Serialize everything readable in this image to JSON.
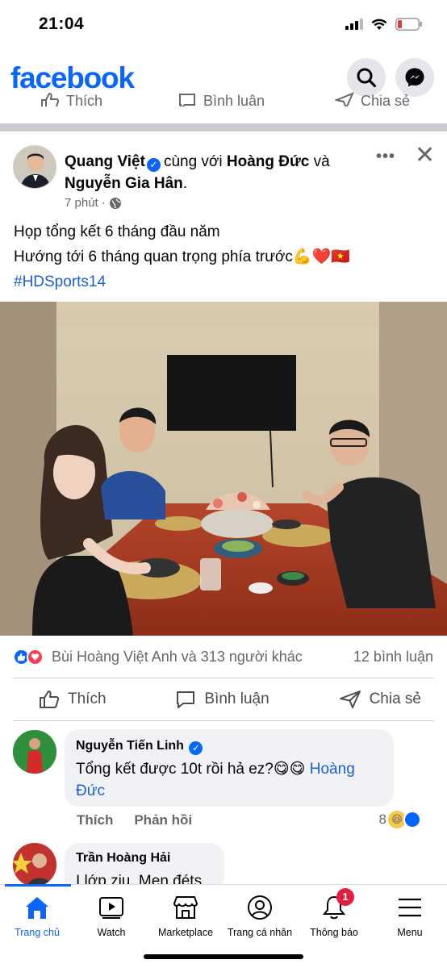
{
  "status_bar": {
    "time": "21:04"
  },
  "header": {
    "logo": "facebook",
    "search_icon": "search-icon",
    "messenger_icon": "messenger-icon",
    "prev_actions": [
      "Thích",
      "Bình luận",
      "Chia sẻ"
    ]
  },
  "post": {
    "author": "Quang Việt",
    "with_text": "cùng với",
    "tagged1": "Hoàng Đức",
    "and_text": "và",
    "tagged2": "Nguyễn Gia Hân",
    "time": "7 phút",
    "privacy_icon": "globe-icon",
    "line1": "Họp tổng kết 6 tháng đầu năm",
    "line2": "Hướng tới 6 tháng quan trọng phía trước💪❤️🇻🇳",
    "hashtag": "#HDSports14",
    "reactions_text": "Bùi Hoàng Việt Anh và 313 người khác",
    "comments_count": "12 bình luận",
    "actions": {
      "like": "Thích",
      "comment": "Bình luận",
      "share": "Chia sẻ"
    }
  },
  "comments": [
    {
      "name": "Nguyễn Tiến Linh",
      "text": "Tổng kết được 10t rồi hả ez?😋😋 ",
      "mention": "Hoàng Đức",
      "like_label": "Thích",
      "reply_label": "Phản hồi",
      "reaction_count": "8"
    },
    {
      "name": "Trần Hoàng Hải",
      "text": "I lớp ziu, Men đéts"
    }
  ],
  "tabs": [
    {
      "label": "Trang chủ",
      "icon": "home-icon"
    },
    {
      "label": "Watch",
      "icon": "video-icon"
    },
    {
      "label": "Marketplace",
      "icon": "store-icon"
    },
    {
      "label": "Trang cá nhân",
      "icon": "profile-icon"
    },
    {
      "label": "Thông báo",
      "icon": "bell-icon",
      "badge": "1"
    },
    {
      "label": "Menu",
      "icon": "menu-icon"
    }
  ],
  "colors": {
    "brand": "#0866ff",
    "badge": "#e41e3f",
    "link": "#1b5fd6"
  }
}
